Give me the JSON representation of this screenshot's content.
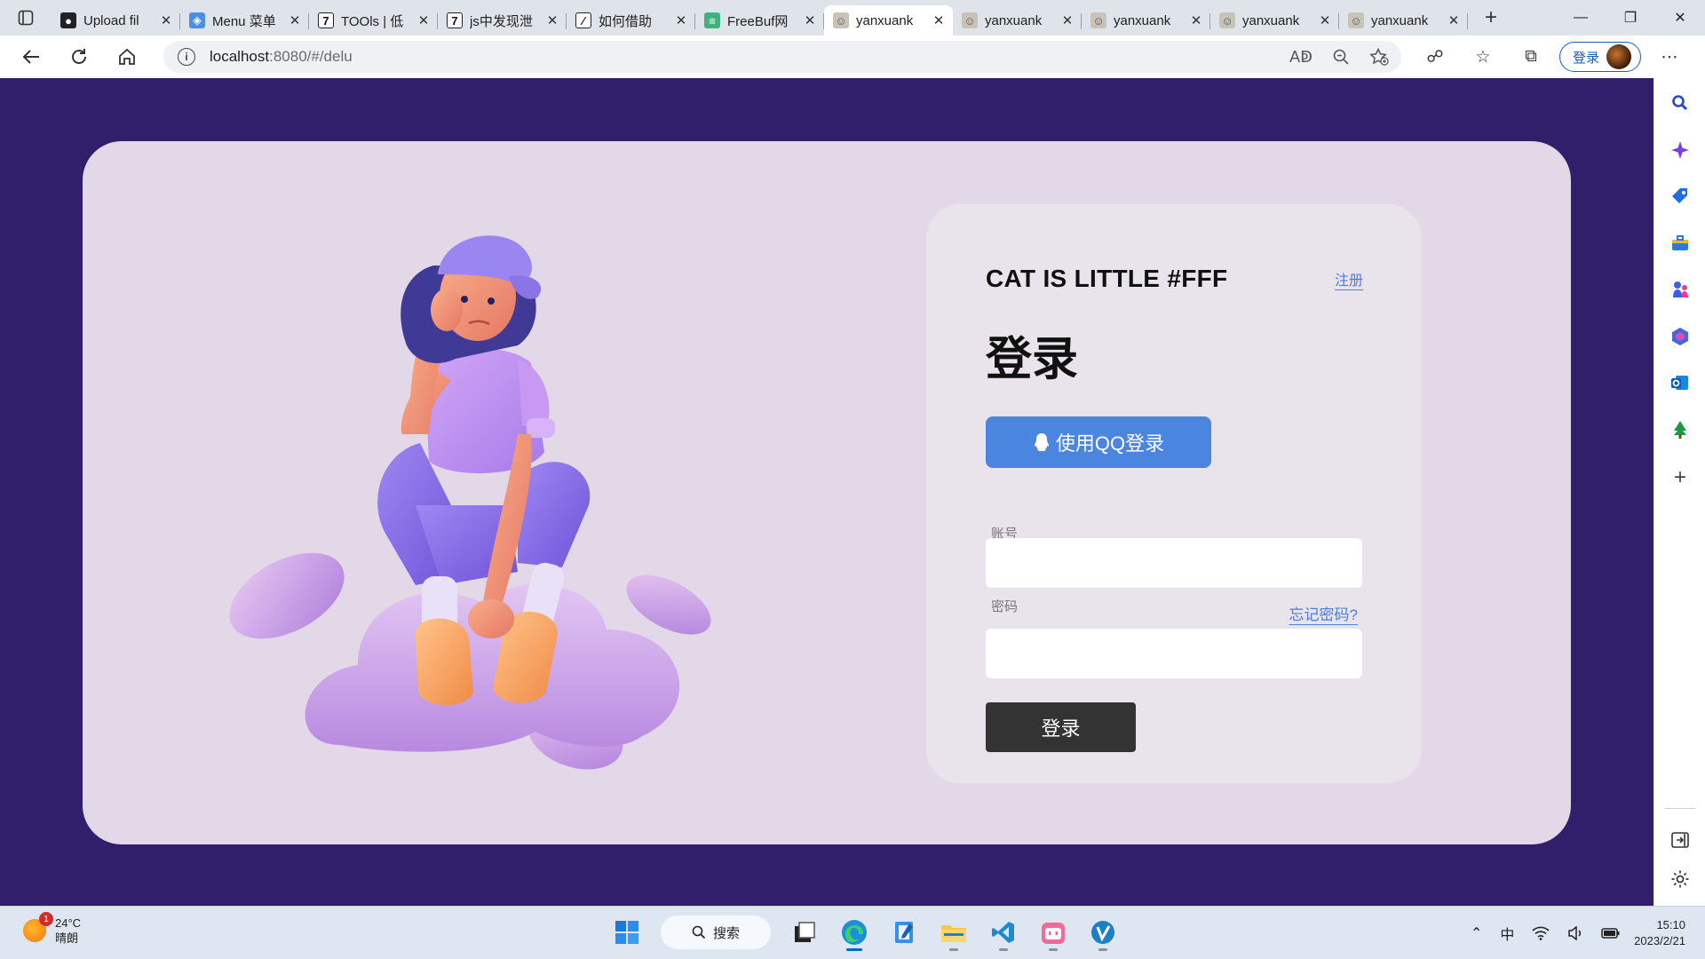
{
  "browser": {
    "tabs": [
      {
        "title": "Upload fil",
        "favicon": "github-icon",
        "active": false
      },
      {
        "title": "Menu 菜单",
        "favicon": "menu-site-icon",
        "active": false
      },
      {
        "title": "TOOls | 低",
        "favicon": "seven-icon",
        "active": false
      },
      {
        "title": "js中发现泄",
        "favicon": "seven-icon",
        "active": false
      },
      {
        "title": "如何借助",
        "favicon": "slash-icon",
        "active": false
      },
      {
        "title": "FreeBuf网",
        "favicon": "freebuf-icon",
        "active": false
      },
      {
        "title": "yanxuank",
        "favicon": "avatar-icon",
        "active": true
      },
      {
        "title": "yanxuank",
        "favicon": "avatar-icon",
        "active": false
      },
      {
        "title": "yanxuank",
        "favicon": "avatar-icon",
        "active": false
      },
      {
        "title": "yanxuank",
        "favicon": "avatar-icon",
        "active": false
      },
      {
        "title": "yanxuank",
        "favicon": "avatar-icon",
        "active": false
      }
    ],
    "url_host": "localhost",
    "url_rest": ":8080/#/delu",
    "signin_label": "登录"
  },
  "page": {
    "brand": "CAT IS LITTLE #FFF",
    "register_link": "注册",
    "heading": "登录",
    "qq_button": "使用QQ登录",
    "account_label": "账号",
    "password_label": "密码",
    "forgot_link": "忘记密码?",
    "submit_button": "登录",
    "colors": {
      "background": "#311f6b",
      "card": "#e3d8e8",
      "panel": "#e9e3ec",
      "accent": "#4a85e0",
      "submit": "#333333"
    }
  },
  "taskbar": {
    "weather_temp": "24°C",
    "weather_desc": "晴朗",
    "weather_badge": "1",
    "search_label": "搜索",
    "ime": "中",
    "time": "15:10",
    "date": "2023/2/21"
  }
}
